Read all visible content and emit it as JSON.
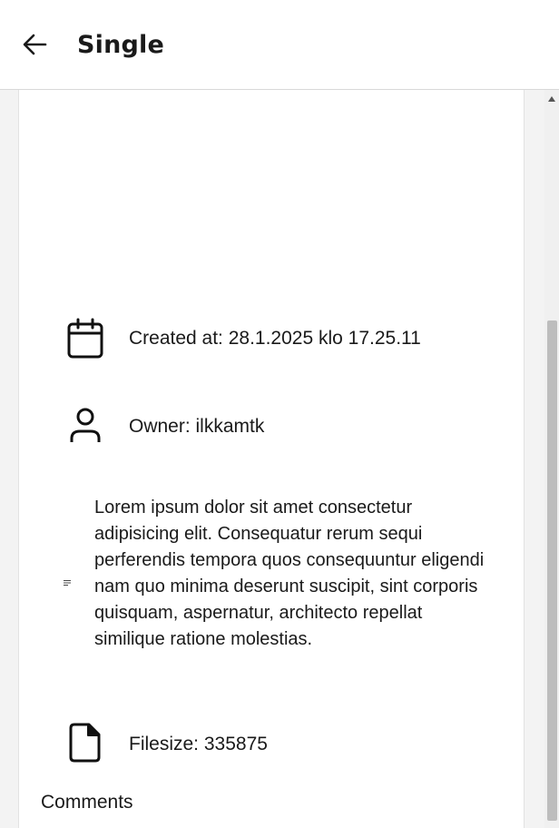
{
  "header": {
    "title": "Single",
    "back_icon": "arrow-left-icon"
  },
  "details": {
    "created_at": "Created at: 28.1.2025 klo 17.25.11",
    "owner": "Owner: ilkkamtk",
    "description": "Lorem ipsum dolor sit amet consectetur adipisicing elit. Consequatur rerum sequi perferendis tempora quos consequuntur eligendi nam quo minima deserunt suscipit, sint corporis quisquam, aspernatur, architecto repellat similique ratione molestias.",
    "filesize": "Filesize: 335875"
  },
  "comments": {
    "heading": "Comments"
  },
  "icons": {
    "created": "calendar-icon",
    "owner": "person-icon",
    "description": "description-icon",
    "filesize": "file-icon"
  },
  "colors": {
    "background": "#ffffff",
    "divider": "#d8d8d8",
    "text": "#1a1a1a",
    "scroll_thumb": "#bdbdbd"
  }
}
